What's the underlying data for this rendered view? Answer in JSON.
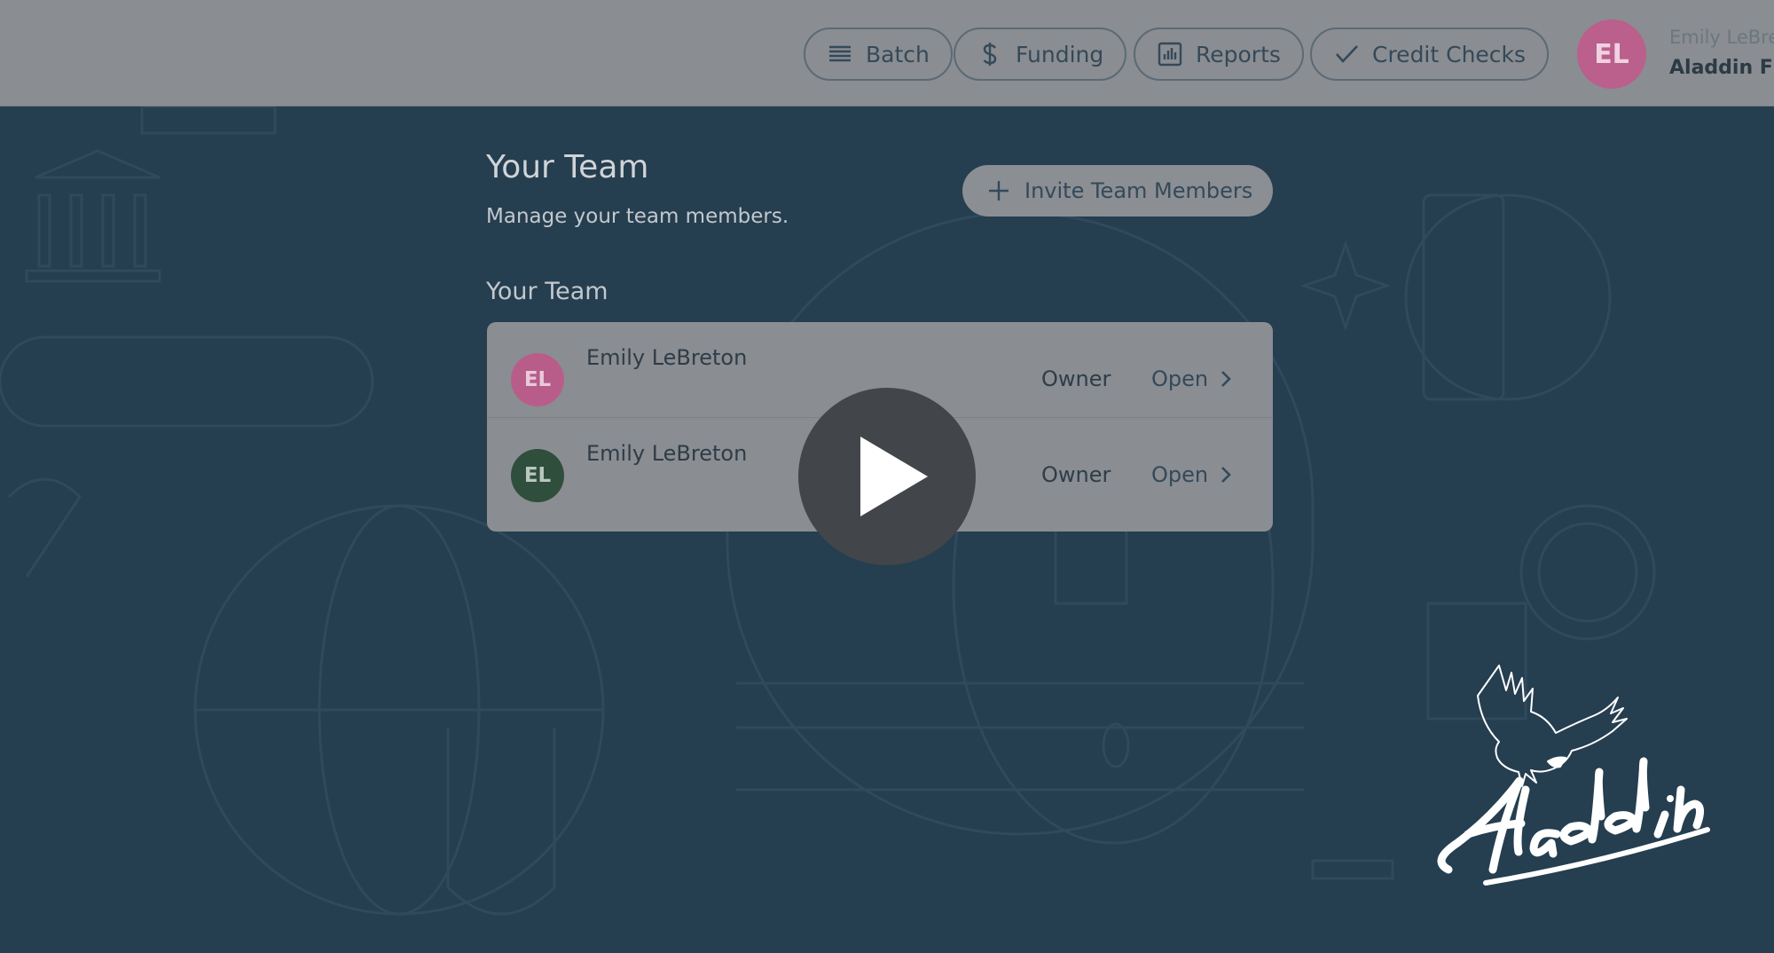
{
  "nav": {
    "items": [
      {
        "label": "Batch",
        "icon": "list-icon"
      },
      {
        "label": "Funding",
        "icon": "dollar-icon"
      },
      {
        "label": "Reports",
        "icon": "bar-chart-icon"
      },
      {
        "label": "Credit Checks",
        "icon": "check-icon"
      }
    ]
  },
  "user": {
    "initials": "EL",
    "name": "Emily LeBret",
    "org": "Aladdin Fin",
    "avatar_color": "#bb5f8c"
  },
  "main": {
    "title": "Your Team",
    "subtitle": "Manage your team members.",
    "invite_label": "Invite Team Members",
    "section_title": "Your Team",
    "members": [
      {
        "initials": "EL",
        "name": "Emily LeBreton",
        "role": "Owner",
        "action": "Open",
        "avatar_color": "#b85d8a",
        "avatar_text_color": "#e9c9da"
      },
      {
        "initials": "EL",
        "name": "Emily LeBreton",
        "role": "Owner",
        "action": "Open",
        "avatar_color": "#2f4e3b",
        "avatar_text_color": "#b9c7bd"
      }
    ]
  },
  "overlay": {
    "icon": "play-icon"
  },
  "brand": {
    "logo_text": "Aladdin"
  }
}
